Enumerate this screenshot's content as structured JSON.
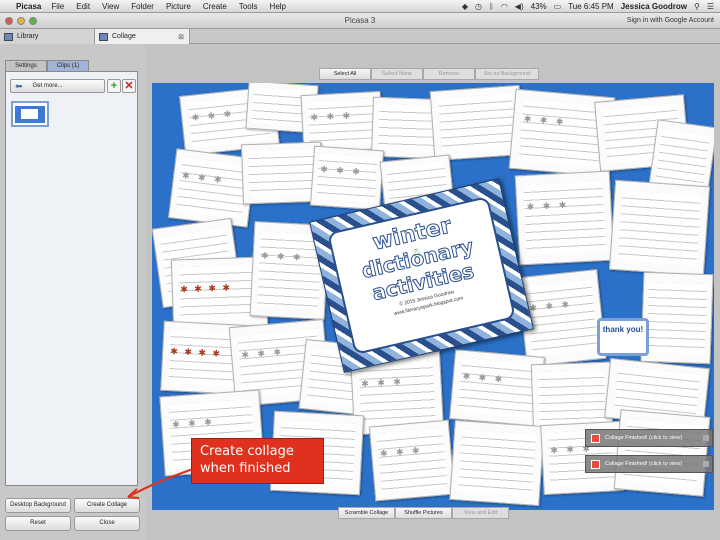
{
  "menubar": {
    "app_name": "Picasa",
    "items": [
      "File",
      "Edit",
      "View",
      "Folder",
      "Picture",
      "Create",
      "Tools",
      "Help"
    ],
    "battery": "43%",
    "clock": "Tue 6:45 PM",
    "user": "Jessica Goodrow"
  },
  "window": {
    "title": "Picasa 3",
    "signin": "Sign in with Google Account"
  },
  "tabs": [
    {
      "label": "Library"
    },
    {
      "label": "Collage"
    }
  ],
  "left_panel": {
    "settings_tab": "Settings",
    "clips_tab": "Clips (1)",
    "get_more": "Get more...",
    "add_symbol": "+",
    "remove_symbol": "✕",
    "desktop_background": "Desktop Background",
    "create_collage": "Create Collage",
    "reset": "Reset",
    "close": "Close"
  },
  "toolbar": {
    "select_all": "Select All",
    "select_none": "Select None",
    "remove": "Remove",
    "set_as_background": "Set as Background"
  },
  "bottom_toolbar": {
    "scramble": "Scramble Collage",
    "shuffle": "Shuffle Pictures",
    "view_edit": "View and Edit"
  },
  "collage": {
    "background_color": "#2b71c9",
    "cover_word1": "winter",
    "cover_word2": "dictionary",
    "cover_word3": "activities",
    "cover_copyright": "© 2015 Jessica Goodrow",
    "cover_site": "www.literacyspark.blogspot.com",
    "thank_you": "thank you!"
  },
  "annotation": {
    "line1": "Create collage",
    "line2": "when finished",
    "color": "#e0301e"
  },
  "notifications": [
    {
      "text": "Collage Finished! (click to view)"
    },
    {
      "text": "Collage Finished! (click to view)"
    }
  ]
}
